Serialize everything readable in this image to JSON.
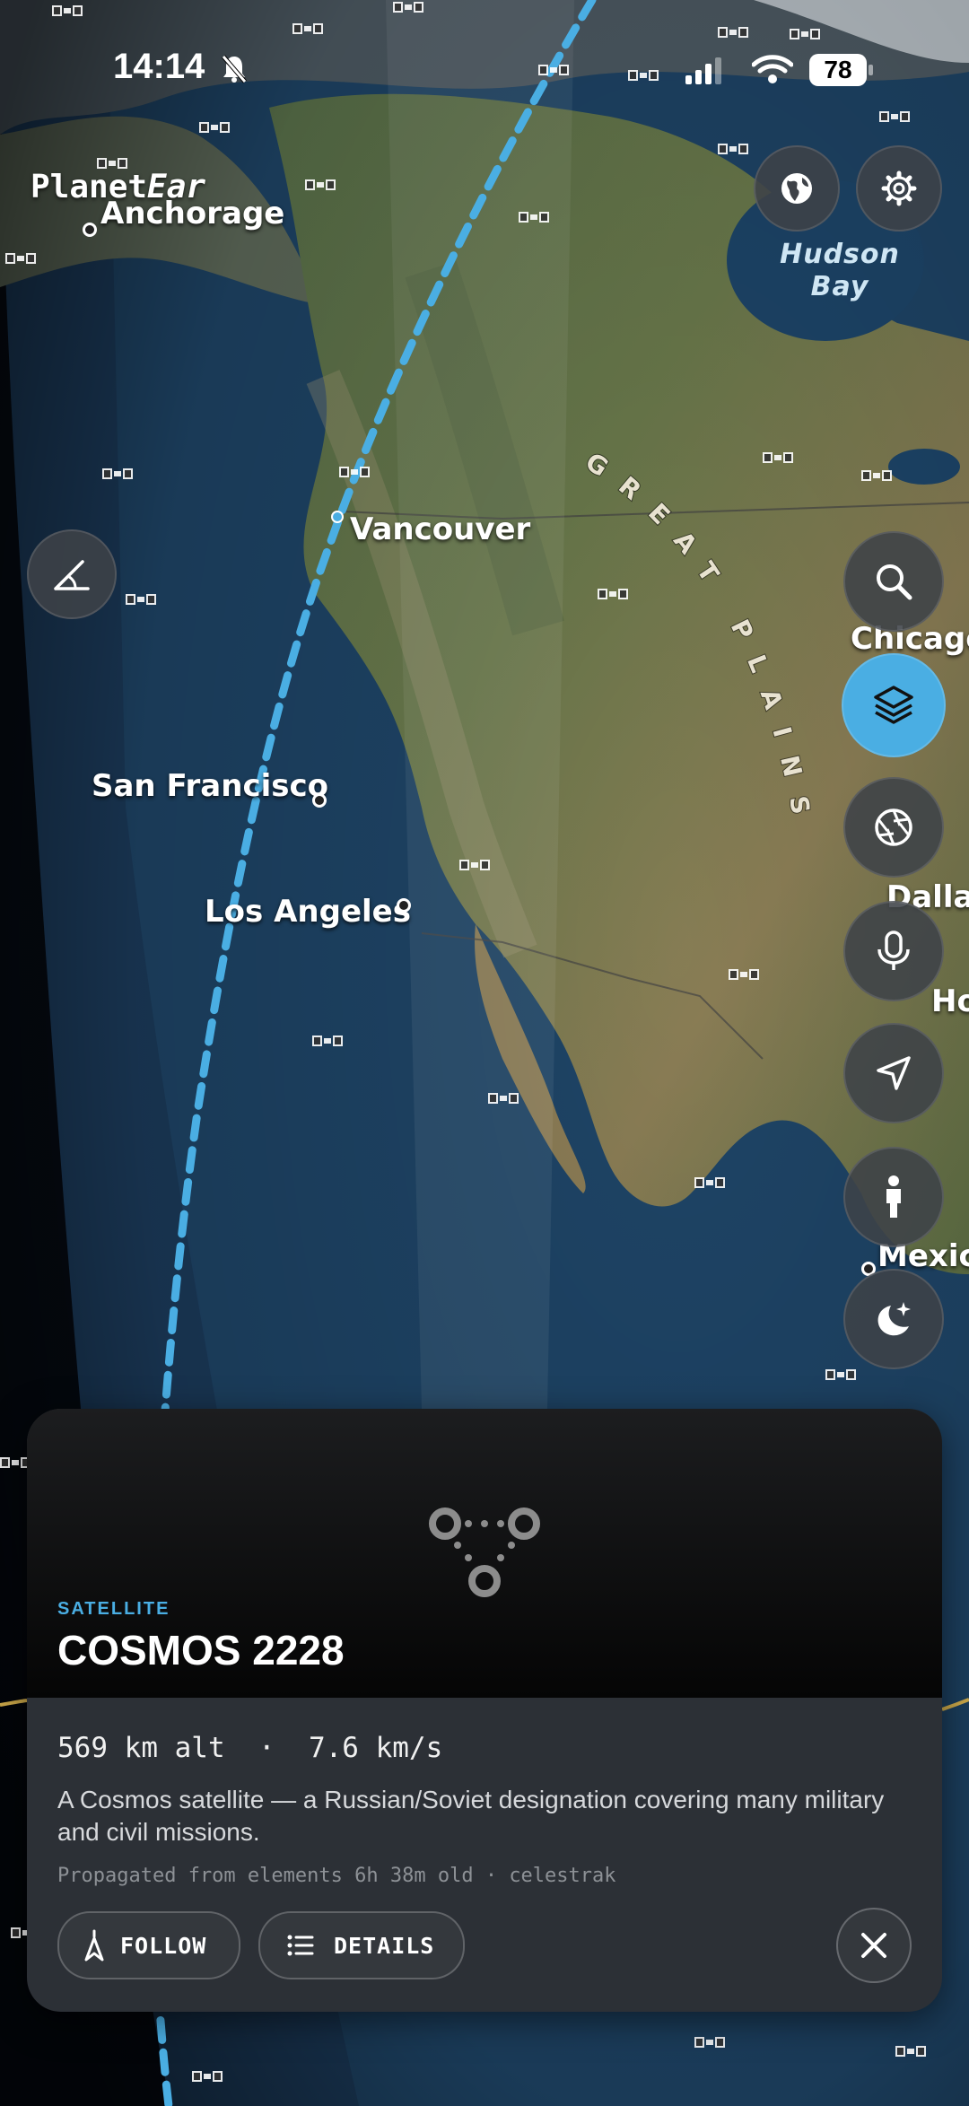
{
  "status_bar": {
    "time": "14:14",
    "battery": "78"
  },
  "app": {
    "brand_prefix": "Planet",
    "brand_suffix": "Ear"
  },
  "map": {
    "cities": {
      "anchorage": "Anchorage",
      "vancouver": "Vancouver",
      "san_francisco": "San Francisco",
      "los_angeles": "Los Angeles",
      "chicago": "Chicago",
      "dallas": "Dallas",
      "houston": "Ho",
      "mexico": "Mexic"
    },
    "water": {
      "hudson_line1": "Hudson",
      "hudson_line2": "Bay"
    },
    "region": {
      "great_plains": "GREAT PLAINS"
    }
  },
  "controls": {
    "globe": "globe-icon",
    "settings": "gear-icon",
    "angle": "angle-icon",
    "search": "search-icon",
    "layers": "layers-icon",
    "aperture": "aperture-icon",
    "microphone": "microphone-icon",
    "location": "location-arrow-icon",
    "person": "person-icon",
    "night": "moon-stars-icon",
    "active_color": "#4aaee3"
  },
  "sheet": {
    "kicker": "SATELLITE",
    "title": "COSMOS 2228",
    "stats": "569 km alt  ·  7.6 km/s",
    "description": "A Cosmos satellite — a Russian/Soviet designation covering many military and civil missions.",
    "propagation": "Propagated from elements 6h 38m old · celestrak",
    "follow_label": "FOLLOW",
    "details_label": "DETAILS"
  }
}
